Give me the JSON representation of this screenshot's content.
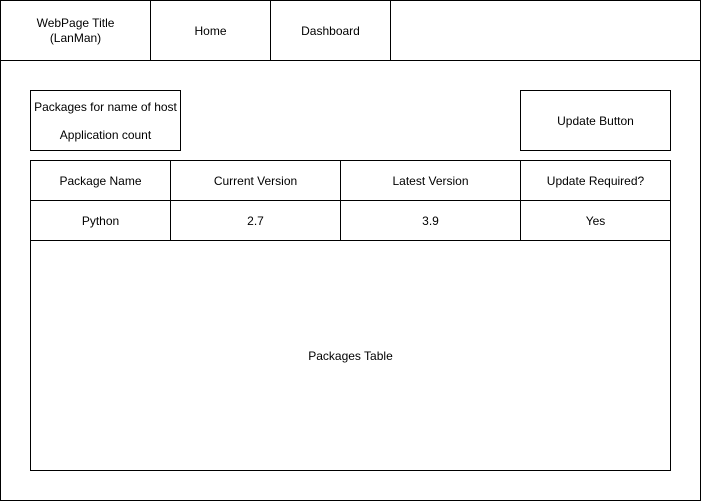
{
  "header": {
    "title_line1": "WebPage Title",
    "title_line2": "(LanMan)",
    "nav": [
      {
        "label": "Home"
      },
      {
        "label": "Dashboard"
      }
    ]
  },
  "info": {
    "host_label": "Packages for name of host",
    "count_label": "Application count"
  },
  "update_button": {
    "label": "Update Button"
  },
  "table": {
    "columns": [
      "Package Name",
      "Current Version",
      "Latest Version",
      "Update Required?"
    ],
    "rows": [
      [
        "Python",
        "2.7",
        "3.9",
        "Yes"
      ]
    ],
    "placeholder": "Packages Table"
  }
}
